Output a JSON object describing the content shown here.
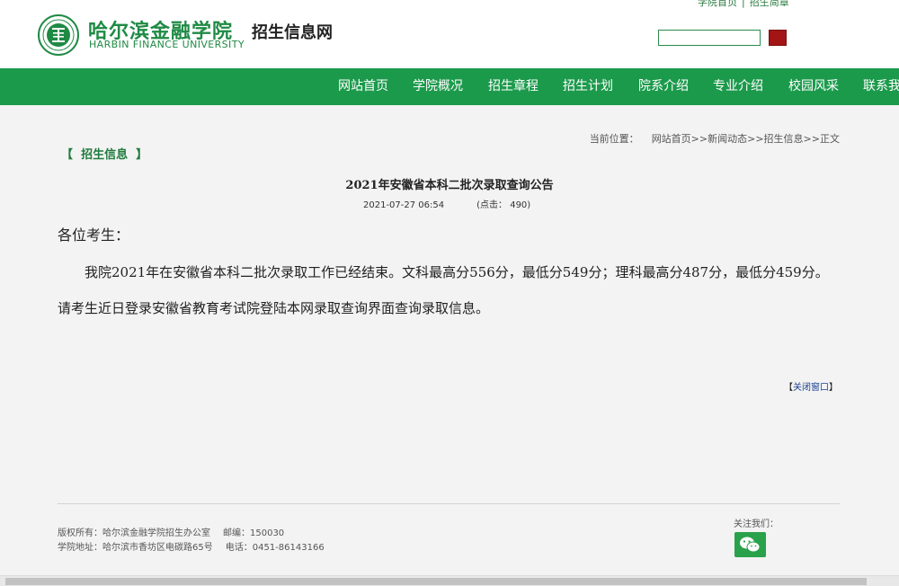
{
  "header": {
    "top_links": [
      "学院首页",
      "招生简章"
    ],
    "logo_cn": "哈尔滨金融学院",
    "logo_en": "HARBIN FINANCE UNIVERSITY",
    "site_title": "招生信息网",
    "search_value": ""
  },
  "nav": {
    "items": [
      "网站首页",
      "学院概况",
      "招生章程",
      "招生计划",
      "院系介绍",
      "专业介绍",
      "校园风采",
      "联系我们"
    ]
  },
  "breadcrumb": {
    "label": "当前位置：",
    "path": "网站首页>>新闻动态>>招生信息>>正文"
  },
  "category": "招生信息",
  "article": {
    "title": "2021年安徽省本科二批次录取查询公告",
    "date": "2021-07-27 06:54",
    "hits": "(点击： 490)",
    "greeting": "各位考生：",
    "body": "我院2021年在安徽省本科二批次录取工作已经结束。文科最高分556分，最低分549分；理科最高分487分，最低分459分。请考生近日登录安徽省教育考试院登陆本网录取查询界面查询录取信息。",
    "close_label": "关闭窗口"
  },
  "footer": {
    "copyright": "版权所有：哈尔滨金融学院招生办公室",
    "postcode": "邮编：150030",
    "address": "学院地址：哈尔滨市香坊区电碳路65号",
    "phone": "电话：0451-86143166",
    "follow_label": "关注我们："
  },
  "colors": {
    "brand_green": "#1c9a4c",
    "search_button": "#a31515",
    "wechat_green": "#2aa14b"
  }
}
